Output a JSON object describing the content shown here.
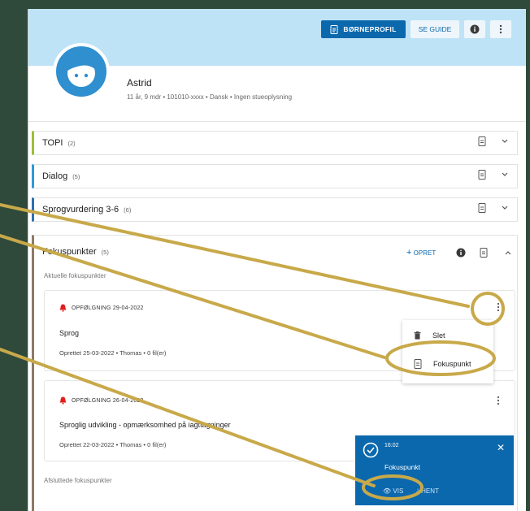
{
  "header": {
    "profile_button": "BØRNEPROFIL",
    "guide_button": "SE GUIDE"
  },
  "child": {
    "name": "Astrid",
    "meta": "11 år, 9 mdr • 101010-xxxx • Dansk • Ingen stueoplysning"
  },
  "sections": [
    {
      "title": "TOPI",
      "count": "(2)",
      "color": "#9bbf3a"
    },
    {
      "title": "Dialog",
      "count": "(5)",
      "color": "#2d9ad6"
    },
    {
      "title": "Sprogvurdering 3-6",
      "count": "(6)",
      "color": "#2f6fb2"
    }
  ],
  "fokus": {
    "title": "Fokuspunkter",
    "count": "(5)",
    "opret": "OPRET",
    "current_label": "Aktuelle fokuspunkter",
    "closed_label": "Afsluttede fokuspunkter",
    "cards": [
      {
        "follow": "OPFØLGNING 29-04-2022",
        "title": "Sprog",
        "meta": "Oprettet 25-03-2022 • Thomas • 0 fil(er)"
      },
      {
        "follow": "OPFØLGNING 26-04-2022",
        "title": "Sproglig udvikling - opmærksomhed på iagttagninger",
        "meta": "Oprettet 22-03-2022 • Thomas • 0 fil(er)"
      }
    ]
  },
  "menu": {
    "delete": "Slet",
    "fokuspunkt": "Fokuspunkt"
  },
  "toast": {
    "time": "16:02",
    "title": "Fokuspunkt",
    "vis": "VIS",
    "hent": "HENT"
  },
  "colors": {
    "accent": "#0b68ad",
    "header_bg": "#bfe3f6",
    "annotation": "#c8a94a",
    "bell": "#e02020"
  }
}
